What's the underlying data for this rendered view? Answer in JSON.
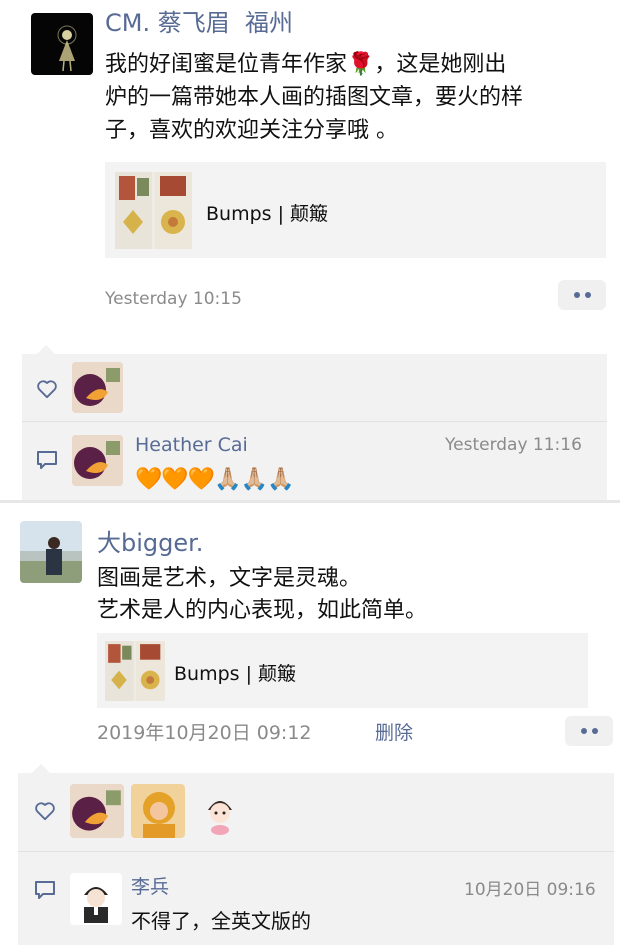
{
  "post1": {
    "author": "CM. 蔡飞眉  福州",
    "text_lines": [
      "我的好闺蜜是位青年作家🌹，这是她刚出",
      "炉的一篇带她本人画的插图文章，要火的样",
      "子，喜欢的欢迎关注分享哦 。"
    ],
    "link_title": "Bumps | 颠簸",
    "time": "Yesterday 10:15",
    "comment": {
      "author": "Heather Cai",
      "time": "Yesterday 11:16",
      "text": "🧡🧡🧡🙏🏼🙏🏼🙏🏼"
    }
  },
  "post2": {
    "author": "大bigger.",
    "text_lines": [
      "图画是艺术，文字是灵魂。",
      "艺术是人的内心表现，如此简单。"
    ],
    "link_title": "Bumps | 颠簸",
    "time": "2019年10月20日 09:12",
    "delete_label": "删除",
    "comment": {
      "author": "李兵",
      "time": "10月20日 09:16",
      "text": "不得了，全英文版的"
    }
  },
  "icons": {
    "like": "heart-outline-icon",
    "comment": "comment-bubble-icon",
    "more": "more-dots-icon"
  },
  "colors": {
    "name_blue": "#576b95",
    "panel_bg": "#f2f2f2",
    "link_bg": "#f3f3f3"
  }
}
